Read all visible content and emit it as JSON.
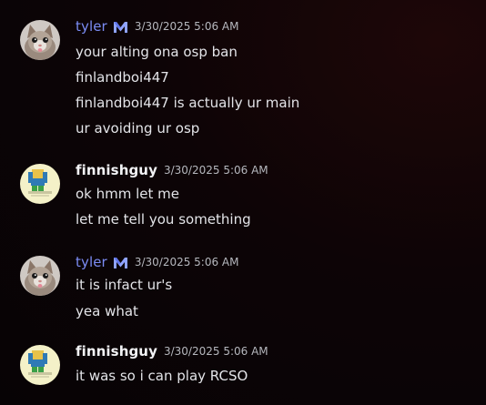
{
  "messages": [
    {
      "author": "tyler",
      "timestamp": "3/30/2025 5:06 AM",
      "lines": [
        "your alting ona  osp ban",
        "finlandboi447",
        "finlandboi447 is actually ur main",
        "ur avoiding ur osp"
      ]
    },
    {
      "author": "finnishguy",
      "timestamp": "3/30/2025 5:06 AM",
      "lines": [
        "ok hmm let me",
        "let me tell you something"
      ]
    },
    {
      "author": "tyler",
      "timestamp": "3/30/2025 5:06 AM",
      "lines": [
        "it is infact ur's",
        "yea what"
      ]
    },
    {
      "author": "finnishguy",
      "timestamp": "3/30/2025 5:06 AM",
      "lines": [
        "it was so i can play RCSO"
      ]
    }
  ],
  "icons": {
    "tyler_badge": "m-logo-icon",
    "tyler_avatar": "cat-avatar-icon",
    "finnishguy_avatar": "roblox-noob-avatar-icon"
  },
  "colors": {
    "tyler_name": "#7b8cf4",
    "finnishguy_name": "#f2f3f5",
    "message_text": "#e3e4e8",
    "timestamp": "#b5b7bd"
  }
}
